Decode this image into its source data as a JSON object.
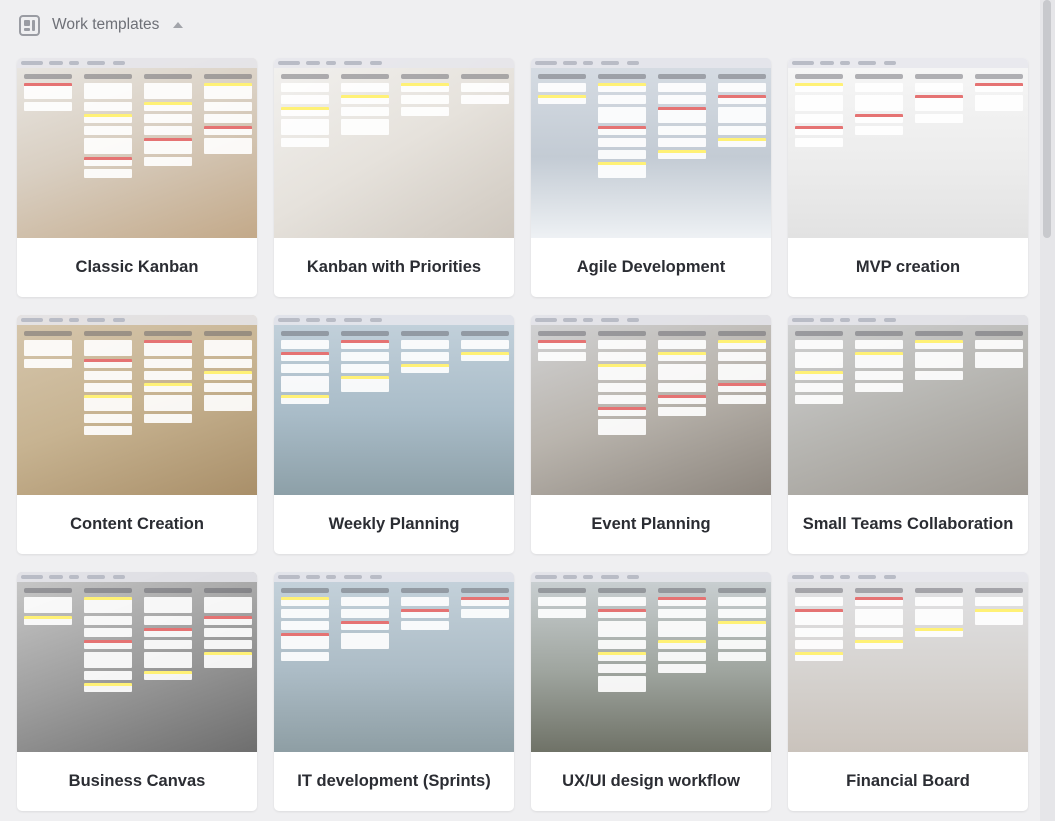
{
  "section": {
    "title": "Work templates",
    "icon": "template-grid-icon",
    "toggle_icon": "caret-up-icon"
  },
  "templates": [
    {
      "name": "Classic Kanban",
      "bg": "linear-gradient(160deg,#e9e7e3 0%,#d9cfc2 45%,#c3a989 100%)"
    },
    {
      "name": "Kanban with Priorities",
      "bg": "linear-gradient(150deg,#f2f1ef 0%,#e6e2dc 50%,#cfc8bf 100%)"
    },
    {
      "name": "Agile Development",
      "bg": "linear-gradient(180deg,#d7dde4 0%,#c3cbd4 55%,#eef1f4 100%)"
    },
    {
      "name": "MVP creation",
      "bg": "linear-gradient(180deg,#f6f6f6 0%,#ececec 60%,#e2e2e2 100%)"
    },
    {
      "name": "Content Creation",
      "bg": "linear-gradient(160deg,#d6c7ae 0%,#c7b391 50%,#a98f69 100%)"
    },
    {
      "name": "Weekly Planning",
      "bg": "linear-gradient(180deg,#c4d2dc 0%,#a9bcc8 55%,#8da0a8 100%)"
    },
    {
      "name": "Event Planning",
      "bg": "linear-gradient(160deg,#d3d4d6 0%,#b9b4ad 50%,#8d867e 100%)"
    },
    {
      "name": "Small Teams Collaboration",
      "bg": "linear-gradient(160deg,#d2d3d4 0%,#b7b6b2 50%,#9d9891 100%)"
    },
    {
      "name": "Business Canvas",
      "bg": "linear-gradient(160deg,#c9c9c9 0%,#9e9e9e 50%,#6e6e6e 100%)"
    },
    {
      "name": "IT development (Sprints)",
      "bg": "linear-gradient(180deg,#c6d3dc 0%,#acbcc6 55%,#8e9ea4 100%)"
    },
    {
      "name": "UX/UI design workflow",
      "bg": "linear-gradient(180deg,#cdd3d6 0%,#9fa59f 55%,#6f7267 100%)"
    },
    {
      "name": "Financial Board",
      "bg": "linear-gradient(180deg,#e2e3e6 0%,#d6d3d0 55%,#cac3bc 100%)"
    }
  ],
  "accents": [
    "#e57373",
    "#81c784",
    "#64b5f6",
    "#fff176",
    "#ba68c8",
    "#ffb74d"
  ]
}
